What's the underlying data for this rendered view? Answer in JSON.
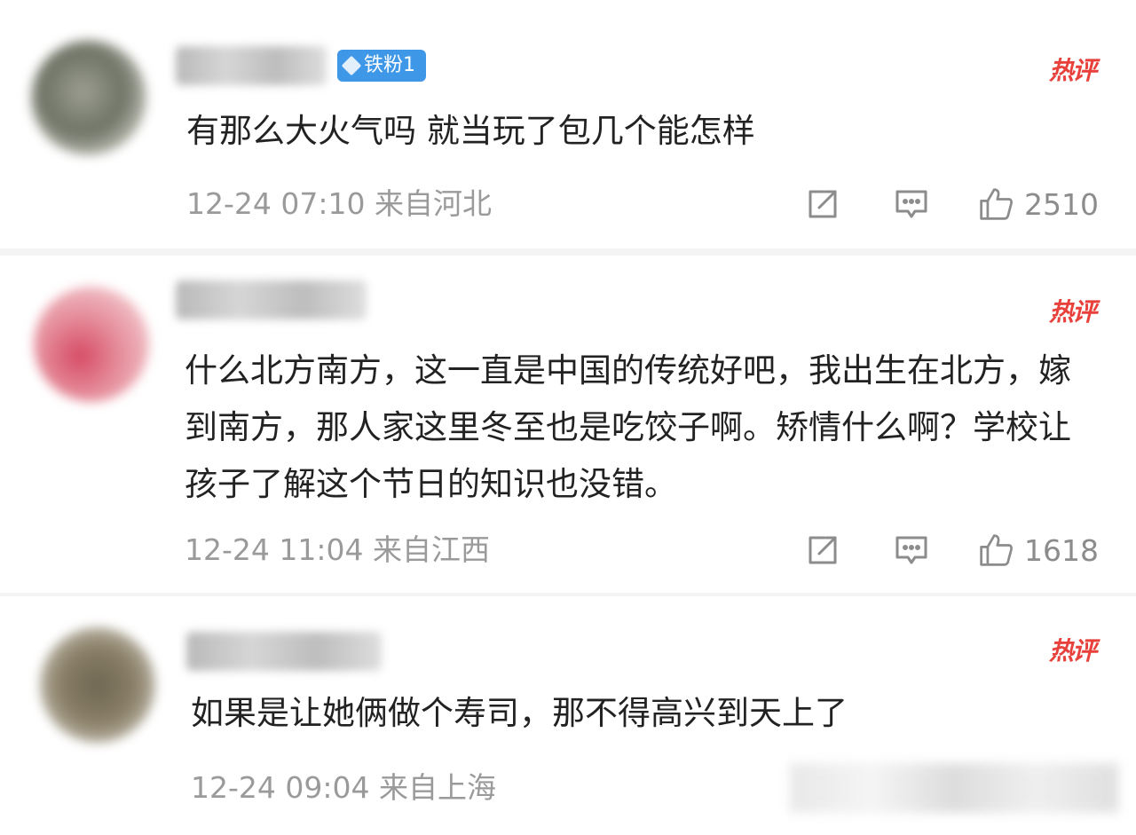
{
  "comments": [
    {
      "badge": "铁粉1",
      "hot_label": "热评",
      "text": "有那么大火气吗 就当玩了包几个能怎样",
      "meta": "12-24 07:10 来自河北",
      "likes": "2510"
    },
    {
      "hot_label": "热评",
      "text": "什么北方南方，这一直是中国的传统好吧，我出生在北方，嫁到南方，那人家这里冬至也是吃饺子啊。矫情什么啊？学校让孩子了解这个节日的知识也没错。",
      "meta": "12-24 11:04 来自江西",
      "likes": "1618"
    },
    {
      "hot_label": "热评",
      "text": "如果是让她俩做个寿司，那不得高兴到天上了",
      "meta": "12-24 09:04 来自上海"
    }
  ],
  "icons": {
    "share": "share-icon",
    "reply": "comment-icon",
    "like": "thumbs-up-icon",
    "badge": "diamond-icon"
  },
  "colors": {
    "hot": "#e8413b",
    "badge": "#3f97e8",
    "meta": "#9a9a9a",
    "text": "#222222"
  }
}
